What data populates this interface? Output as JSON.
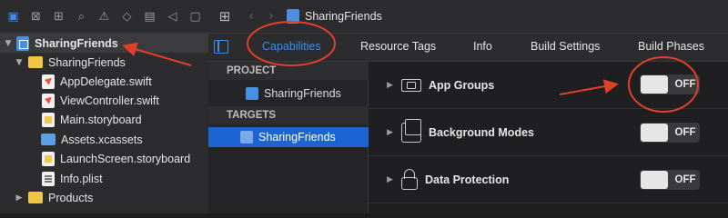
{
  "navigator": {
    "toolbar_icons": [
      "folder-icon",
      "xcode-source-icon",
      "hierarchy-icon",
      "search-icon",
      "warning-icon",
      "diamond-icon",
      "breakpoint-icon",
      "tag-icon",
      "message-icon"
    ],
    "items": [
      {
        "label": "SharingFriends",
        "icon": "project-icon",
        "disclosure": "▼"
      },
      {
        "label": "SharingFriends",
        "icon": "folder-icon",
        "disclosure": "▼"
      },
      {
        "label": "AppDelegate.swift",
        "icon": "swift-file-icon",
        "disclosure": ""
      },
      {
        "label": "ViewController.swift",
        "icon": "swift-file-icon",
        "disclosure": ""
      },
      {
        "label": "Main.storyboard",
        "icon": "storyboard-icon",
        "disclosure": ""
      },
      {
        "label": "Assets.xcassets",
        "icon": "assets-icon",
        "disclosure": ""
      },
      {
        "label": "LaunchScreen.storyboard",
        "icon": "storyboard-icon",
        "disclosure": ""
      },
      {
        "label": "Info.plist",
        "icon": "plist-icon",
        "disclosure": ""
      },
      {
        "label": "Products",
        "icon": "folder-icon",
        "disclosure": "▶"
      }
    ]
  },
  "topbar": {
    "back": "‹",
    "forward": "›",
    "project_name": "SharingFriends"
  },
  "tabs": [
    {
      "label": "Capabilities",
      "active": true
    },
    {
      "label": "Resource Tags",
      "active": false
    },
    {
      "label": "Info",
      "active": false
    },
    {
      "label": "Build Settings",
      "active": false
    },
    {
      "label": "Build Phases",
      "active": false
    }
  ],
  "targets_panel": {
    "project_header": "PROJECT",
    "project_item": "SharingFriends",
    "targets_header": "TARGETS",
    "target_item": "SharingFriends"
  },
  "capabilities": [
    {
      "name": "App Groups",
      "icon": "app-groups-icon",
      "state": "OFF"
    },
    {
      "name": "Background Modes",
      "icon": "background-modes-icon",
      "state": "OFF"
    },
    {
      "name": "Data Protection",
      "icon": "lock-icon",
      "state": "OFF"
    }
  ],
  "colors": {
    "accent": "#3b8ef0",
    "selection": "#1b64d2",
    "annotation": "#e0402a"
  }
}
